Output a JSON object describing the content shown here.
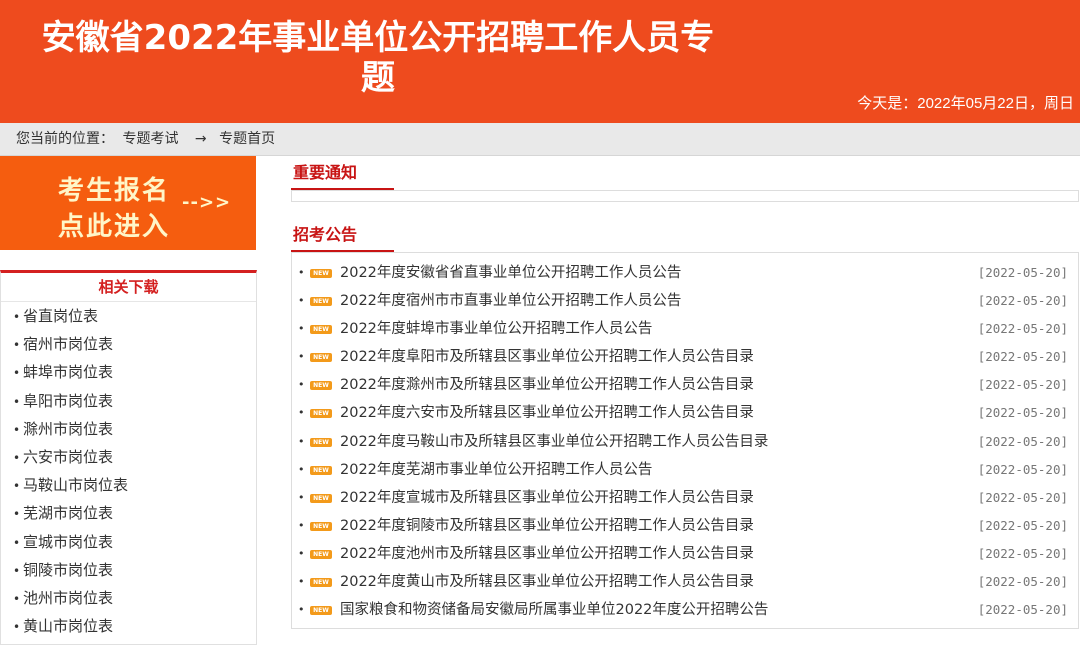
{
  "header": {
    "title": "安徽省2022年事业单位公开招聘工作人员专题",
    "date": "今天是：2022年05月22日，周日"
  },
  "breadcrumb": {
    "label": "您当前的位置：",
    "item1": "专题考试",
    "sep": "→",
    "item2": "专题首页"
  },
  "banner": {
    "line1": "考生报名",
    "line2": "点此进入",
    "arrow": "-->>"
  },
  "downloads": {
    "title": "相关下载",
    "items": [
      "省直岗位表",
      "宿州市岗位表",
      "蚌埠市岗位表",
      "阜阳市岗位表",
      "滁州市岗位表",
      "六安市岗位表",
      "马鞍山市岗位表",
      "芜湖市岗位表",
      "宣城市岗位表",
      "铜陵市岗位表",
      "池州市岗位表",
      "黄山市岗位表"
    ]
  },
  "notice": {
    "title": "重要通知"
  },
  "announcements": {
    "title": "招考公告",
    "badge": "NEW",
    "items": [
      {
        "title": "2022年度安徽省省直事业单位公开招聘工作人员公告",
        "date": "[2022-05-20]"
      },
      {
        "title": "2022年度宿州市市直事业单位公开招聘工作人员公告",
        "date": "[2022-05-20]"
      },
      {
        "title": "2022年度蚌埠市事业单位公开招聘工作人员公告",
        "date": "[2022-05-20]"
      },
      {
        "title": "2022年度阜阳市及所辖县区事业单位公开招聘工作人员公告目录",
        "date": "[2022-05-20]"
      },
      {
        "title": "2022年度滁州市及所辖县区事业单位公开招聘工作人员公告目录",
        "date": "[2022-05-20]"
      },
      {
        "title": "2022年度六安市及所辖县区事业单位公开招聘工作人员公告目录",
        "date": "[2022-05-20]"
      },
      {
        "title": "2022年度马鞍山市及所辖县区事业单位公开招聘工作人员公告目录",
        "date": "[2022-05-20]"
      },
      {
        "title": "2022年度芜湖市事业单位公开招聘工作人员公告",
        "date": "[2022-05-20]"
      },
      {
        "title": "2022年度宣城市及所辖县区事业单位公开招聘工作人员公告目录",
        "date": "[2022-05-20]"
      },
      {
        "title": "2022年度铜陵市及所辖县区事业单位公开招聘工作人员公告目录",
        "date": "[2022-05-20]"
      },
      {
        "title": "2022年度池州市及所辖县区事业单位公开招聘工作人员公告目录",
        "date": "[2022-05-20]"
      },
      {
        "title": "2022年度黄山市及所辖县区事业单位公开招聘工作人员公告目录",
        "date": "[2022-05-20]"
      },
      {
        "title": "国家粮食和物资储备局安徽局所属事业单位2022年度公开招聘公告",
        "date": "[2022-05-20]"
      }
    ]
  }
}
